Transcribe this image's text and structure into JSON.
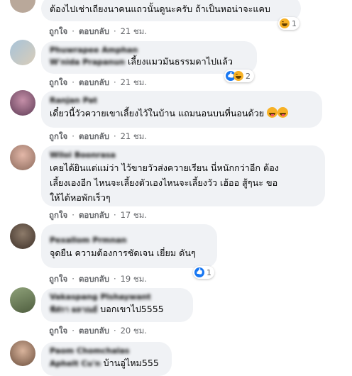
{
  "comments": [
    {
      "name": "",
      "subname": "",
      "text": "ต้องไปเช่าเถียงนาคนแถวนั้นดูนะครับ ถ้าเป็นหอน่าจะแคบ",
      "actions": {
        "like": "ถูกใจ",
        "reply": "ตอบกลับ",
        "time": "21 ชม."
      },
      "reaction_count": "1",
      "reaction_icons": [
        "haha-icon"
      ]
    },
    {
      "name": "Phuwrapee Amphan",
      "subname": "W'nida Prapanun",
      "text": "เลี้ยงแมวมันธรรมดาไปแล้ว",
      "actions": {
        "like": "ถูกใจ",
        "reply": "ตอบกลับ",
        "time": "21 ชม."
      },
      "reaction_count": "2",
      "reaction_icons": [
        "like-icon",
        "haha-icon"
      ]
    },
    {
      "name": "Ranjan Pat",
      "text": "เดี๋ยวนี้วัวควายเขาเลี้ยงไว้ในบ้าน แถมนอนบนที่นอนด้วย",
      "actions": {
        "like": "ถูกใจ",
        "reply": "ตอบกลับ",
        "time": "21 ชม."
      }
    },
    {
      "name": "Wiloi Boonrasa",
      "text": "เคยได้ยินแต่แม่ว่า ไว้ขายวัวส่งควายเรียน นี่หนักกว่าอีก ต้องเลี้ยงเองอีก ไหนจะเลี้ยงตัวเองไหนจะเลี้ยงวัว เฮ้ออ สู้ๆนะ ขอให้ได้หอพักเร็วๆ",
      "text_lines": [
        "เคยได้ยินแต่แม่ว่า ไว้ขายวัวส่งควายเรียน นี่หนักกว่าอีก ต้อง",
        "เลี้ยงเองอีก ไหนจะเลี้ยงตัวเองไหนจะเลี้ยงวัว เฮ้ออ สู้ๆนะ ขอ",
        "ให้ได้หอพักเร็วๆ"
      ],
      "actions": {
        "like": "ถูกใจ",
        "reply": "ตอบกลับ",
        "time": "17 ชม."
      }
    },
    {
      "name": "Pexallom Prmnan",
      "text": "จุดยืน ความต้องการชัดเจน เยี่ยม ดันๆ",
      "actions": {
        "like": "ถูกใจ",
        "reply": "ตอบกลับ",
        "time": "19 ชม."
      },
      "reaction_count": "1",
      "reaction_icons": [
        "like-icon"
      ]
    },
    {
      "name": "Vakaspang Plshaywant",
      "subname": "ฟัส่กา ผลาณย์",
      "text": "บอกเขาไป5555",
      "actions": {
        "like": "ถูกใจ",
        "reply": "ตอบกลับ",
        "time": "20 ชม."
      }
    },
    {
      "name": "Paom Chomchalas",
      "subname": "Aphelt Cu'n",
      "text": "บ้านอู่ไหม555"
    }
  ],
  "colors": {
    "bubble": "#f0f2f5",
    "muted": "#65676b",
    "haha": "#f7b125",
    "like": "#1877f2"
  }
}
